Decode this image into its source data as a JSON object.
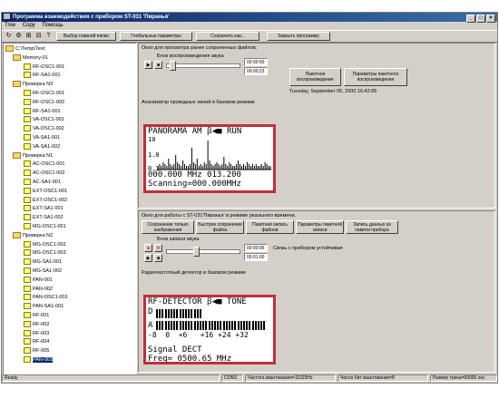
{
  "window": {
    "title": "Программа взаимодействия с прибором ST-031 'Пиранья'"
  },
  "menu": [
    "Tree",
    "Copy",
    "Помощь"
  ],
  "toolbar": {
    "icons": [
      "refresh-icon",
      "gear-icon",
      "tree-add-icon",
      "tree-remove-icon",
      "help-icon"
    ],
    "buttons": [
      "Выбор главной папки",
      "Глобальные параметры",
      "Сохранить как...",
      "Закрыть программу"
    ]
  },
  "tree": [
    {
      "label": "C:\\Temp\\Test",
      "type": "root"
    },
    {
      "label": "Memory-01",
      "type": "folder"
    },
    {
      "label": "RF-OSC1-001",
      "type": "file"
    },
    {
      "label": "RF-SA1-001",
      "type": "file"
    },
    {
      "label": "Проверка N3",
      "type": "folder"
    },
    {
      "label": "RF-OSC1-001",
      "type": "file"
    },
    {
      "label": "RF-OSC1-002",
      "type": "file"
    },
    {
      "label": "RF-SA1-001",
      "type": "file"
    },
    {
      "label": "VA-OSC1-001",
      "type": "file"
    },
    {
      "label": "VA-OSC1-002",
      "type": "file"
    },
    {
      "label": "VA-SA1-001",
      "type": "file"
    },
    {
      "label": "VA-SA1-002",
      "type": "file"
    },
    {
      "label": "Проверка N1",
      "type": "folder"
    },
    {
      "label": "AC-OSC1-001",
      "type": "file"
    },
    {
      "label": "AC-OSC1-002",
      "type": "file"
    },
    {
      "label": "AC-SA1-001",
      "type": "file"
    },
    {
      "label": "EXT-OSC1-001",
      "type": "file"
    },
    {
      "label": "EXT-OSC1-002",
      "type": "file"
    },
    {
      "label": "EXT-SA1-001",
      "type": "file"
    },
    {
      "label": "EXT-SA1-002",
      "type": "file"
    },
    {
      "label": "MG-OSC1-001",
      "type": "file"
    },
    {
      "label": "Проверка N2",
      "type": "folder"
    },
    {
      "label": "MG-OSC1-002",
      "type": "file"
    },
    {
      "label": "MG-OSC1-003",
      "type": "file"
    },
    {
      "label": "MG-SA1-001",
      "type": "file"
    },
    {
      "label": "MG-SA1-002",
      "type": "file"
    },
    {
      "label": "PAN-001",
      "type": "file"
    },
    {
      "label": "PAN-002",
      "type": "file"
    },
    {
      "label": "PAN-OSC1-001",
      "type": "file"
    },
    {
      "label": "PAN-SA1-001",
      "type": "file"
    },
    {
      "label": "RF-001",
      "type": "file"
    },
    {
      "label": "RF-002",
      "type": "file"
    },
    {
      "label": "RF-003",
      "type": "file"
    },
    {
      "label": "RF-004",
      "type": "file"
    },
    {
      "label": "RF-005",
      "type": "file"
    },
    {
      "label": "PAN-003",
      "type": "file",
      "selected": true
    }
  ],
  "top_panel": {
    "title": "Окно для просмотра ранее сохраненных файлов.",
    "playback_label": "Блок воспроизведения звука",
    "time1": "00:00:00",
    "time2": "00:00:23",
    "btn_packet": "Пакетное воспроизведение",
    "btn_packet_params": "Параметры пакетного воспроизведения",
    "date": "Tuesday, September 05, 2000 16:42:05",
    "analyzer_label": "Анализатор проводных линий в базовом режиме",
    "lcd": {
      "header": "PANORAMA AM",
      "mode": "RUN",
      "y_top": "10",
      "y_mid": "1.0",
      "y_bot": "0.1",
      "freq_left": "000.000",
      "unit": "MHz",
      "freq_right": "013.200",
      "scanning": "Scanning=000.000MHz",
      "spectrum": [
        2,
        3,
        2,
        4,
        3,
        2,
        6,
        3,
        2,
        3,
        8,
        4,
        3,
        2,
        5,
        3,
        2,
        2,
        3,
        12,
        4,
        3,
        6,
        2,
        3,
        2,
        4,
        3,
        16,
        5,
        3,
        2,
        3,
        4,
        3,
        2,
        3,
        7,
        3,
        2,
        4,
        3,
        2,
        2,
        3,
        5,
        3,
        2,
        3,
        2,
        4,
        3,
        2,
        3,
        2,
        3,
        2,
        2,
        3,
        2,
        4,
        3,
        2,
        2
      ]
    }
  },
  "bottom_panel": {
    "title": "Окно для работы с ST-031'Пиранья' в режиме реального времени.",
    "buttons": [
      "Сохранение только изображения",
      "Быстрое сохранение файла",
      "Пакетная запись файлов",
      "Параметры пакетной записи",
      "Запись данных из памяти прибора"
    ],
    "record_label": "Блок записи звука",
    "time1": "00:00:06",
    "time2": "00:01:00",
    "connection": "Связь с прибором устойчивая",
    "detector_label": "Радиочастотный детектор в базовом режиме",
    "lcd": {
      "header": "RF-DETECTOR",
      "mode": "TONE",
      "row_d": "D",
      "row_a": "A",
      "scale": "-8  0  +6   +16 +24 +32",
      "bars_d": 16,
      "bars_a": 38,
      "signal": "Signal DECT",
      "freq": "Freq= 0500.65 MHz"
    }
  },
  "status": [
    "Ready",
    "COM1",
    "Частота квантования=11025Hz",
    "Число бит квантования=8",
    "Размер трека=60000 sec"
  ]
}
